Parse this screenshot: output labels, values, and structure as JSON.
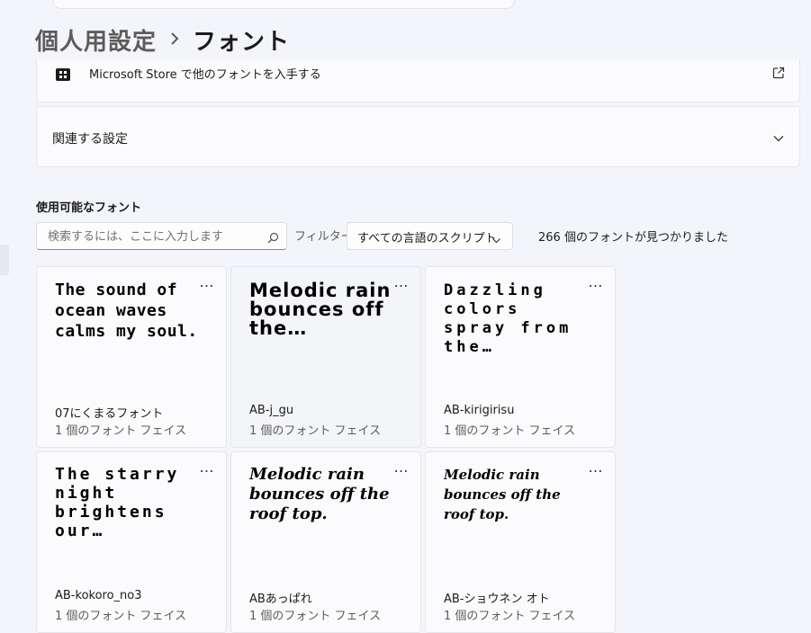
{
  "breadcrumb": {
    "parent": "個人用設定",
    "current": "フォント"
  },
  "store_link": {
    "label": "Microsoft Store で他のフォントを入手する",
    "icon": "store-icon",
    "trailing_icon": "external-link-icon"
  },
  "related": {
    "label": "関連する設定",
    "icon": "chevron-down-icon"
  },
  "fonts_section": {
    "title": "使用可能なフォント",
    "search_placeholder": "検索するには、ここに入力します",
    "filter_label": "フィルター:",
    "filter_value": "すべての言語のスクリプト",
    "count_text": "266 個のフォントが見つかりました"
  },
  "tiles": [
    {
      "sample": "The sound of ocean waves calms my soul.",
      "name": "07にくまるフォント",
      "faces": "1 個のフォント フェイス",
      "more": "…"
    },
    {
      "sample": "Melodic rain bounces off the…",
      "name": "AB-j_gu",
      "faces": "1 個のフォント フェイス",
      "more": "…"
    },
    {
      "sample": "Dazzling colors spray from the…",
      "name": "AB-kirigirisu",
      "faces": "1 個のフォント フェイス",
      "more": "…"
    },
    {
      "sample": "The starry night brightens our…",
      "name": "AB-kokoro_no3",
      "faces": "1 個のフォント フェイス",
      "more": "…"
    },
    {
      "sample": "Melodic rain bounces off the roof top.",
      "name": "ABあっぱれ",
      "faces": "1 個のフォント フェイス",
      "more": "…"
    },
    {
      "sample": "Melodic rain bounces off the roof top.",
      "name": "AB-ショウネン オト",
      "faces": "1 個のフォント フェイス",
      "more": "…"
    }
  ],
  "colors": {
    "background": "#f3f5fa",
    "card": "#fbfbfd",
    "text": "#1b1b1b",
    "secondary_text": "#5c5c5c"
  }
}
